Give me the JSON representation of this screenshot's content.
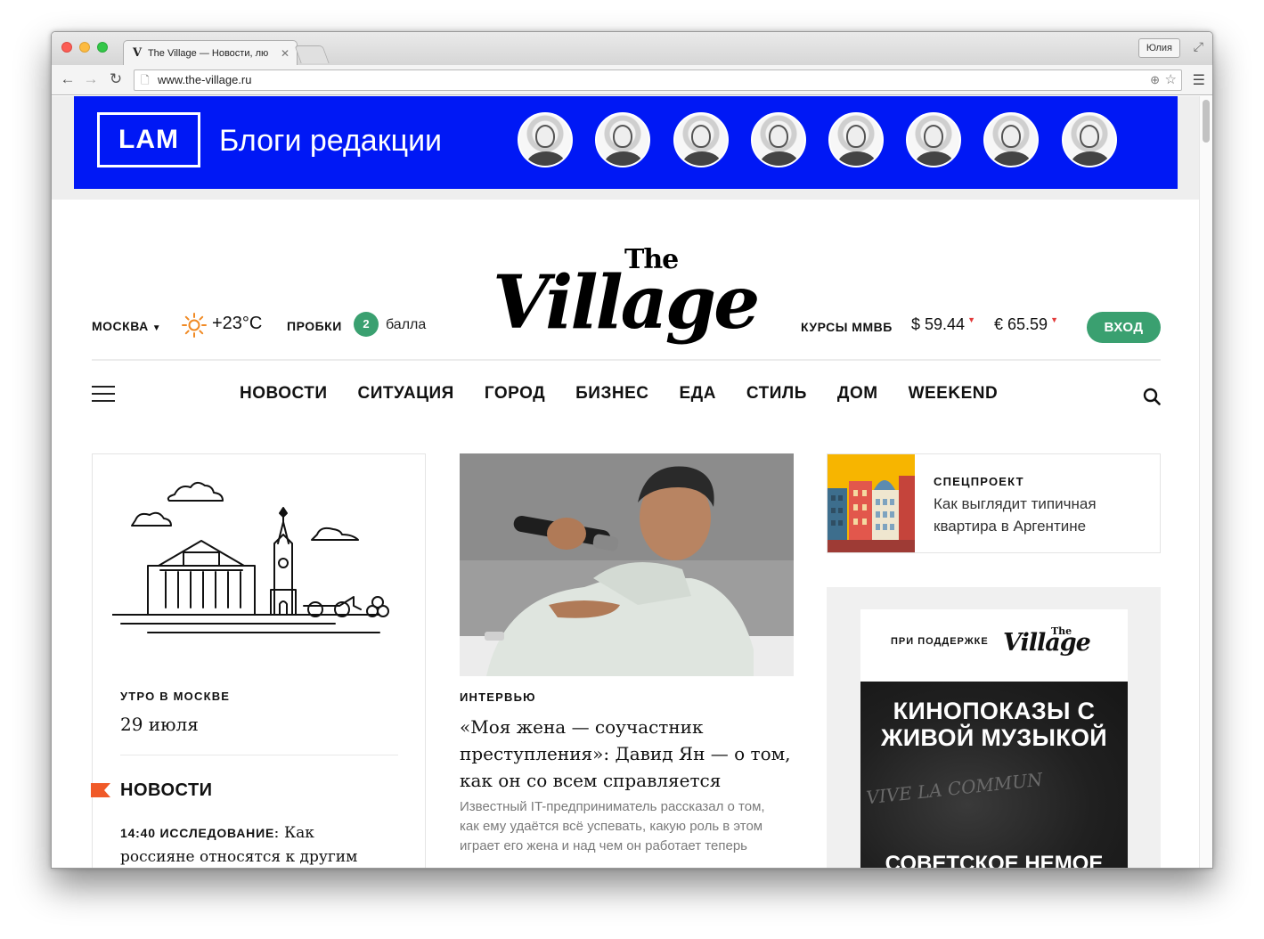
{
  "browser": {
    "tab_title": "The Village — Новости, лю",
    "tab_favicon": "V",
    "profile_name": "Юлия",
    "url": "www.the-village.ru"
  },
  "banner": {
    "logo": "LAM",
    "title": "Блоги редакции",
    "background": "#0018f5",
    "avatar_count": 8
  },
  "header": {
    "logo_the": "The",
    "logo_village": "Village",
    "city": "МОСКВА",
    "temperature": "+23°C",
    "traffic_label": "ПРОБКИ",
    "traffic_level": "2",
    "traffic_units": "балла",
    "rates_label": "КУРСЫ ММВБ",
    "usd": "$ 59.44",
    "eur": "€ 65.59",
    "login": "ВХОД",
    "accent": "#3aa070"
  },
  "nav": {
    "items": [
      "НОВОСТИ",
      "СИТУАЦИЯ",
      "ГОРОД",
      "БИЗНЕС",
      "ЕДА",
      "СТИЛЬ",
      "ДОМ",
      "WEEKEND"
    ]
  },
  "morning": {
    "kicker": "УТРО В МОСКВЕ",
    "date": "29 июля"
  },
  "news": {
    "heading": "НОВОСТИ",
    "items": [
      {
        "time": "14:40 ИССЛЕДОВАНИЕ:",
        "title": "Как россияне относятся к другим странам"
      }
    ]
  },
  "feature": {
    "kicker": "ИНТЕРВЬЮ",
    "title": "«Моя жена — соучастник преступления»: Давид Ян — о том, как он со всем справляется",
    "lead": "Известный IT-предприниматель рассказал о том, как ему удаётся всё успевать, какую роль в этом играет его жена и над чем он работает теперь"
  },
  "special": {
    "kicker": "СПЕЦПРОЕКТ",
    "title": "Как выглядит типичная квартира в Аргентине"
  },
  "ad": {
    "support": "ПРИ ПОДДЕРЖКЕ",
    "logo_the": "The",
    "logo": "Village",
    "title": "КИНОПОКАЗЫ С ЖИВОЙ МУЗЫКОЙ",
    "graffiti": "VIVE LA COMMUN",
    "subtitle": "СОВЕТСКОЕ НЕМОЕ КИНО"
  }
}
